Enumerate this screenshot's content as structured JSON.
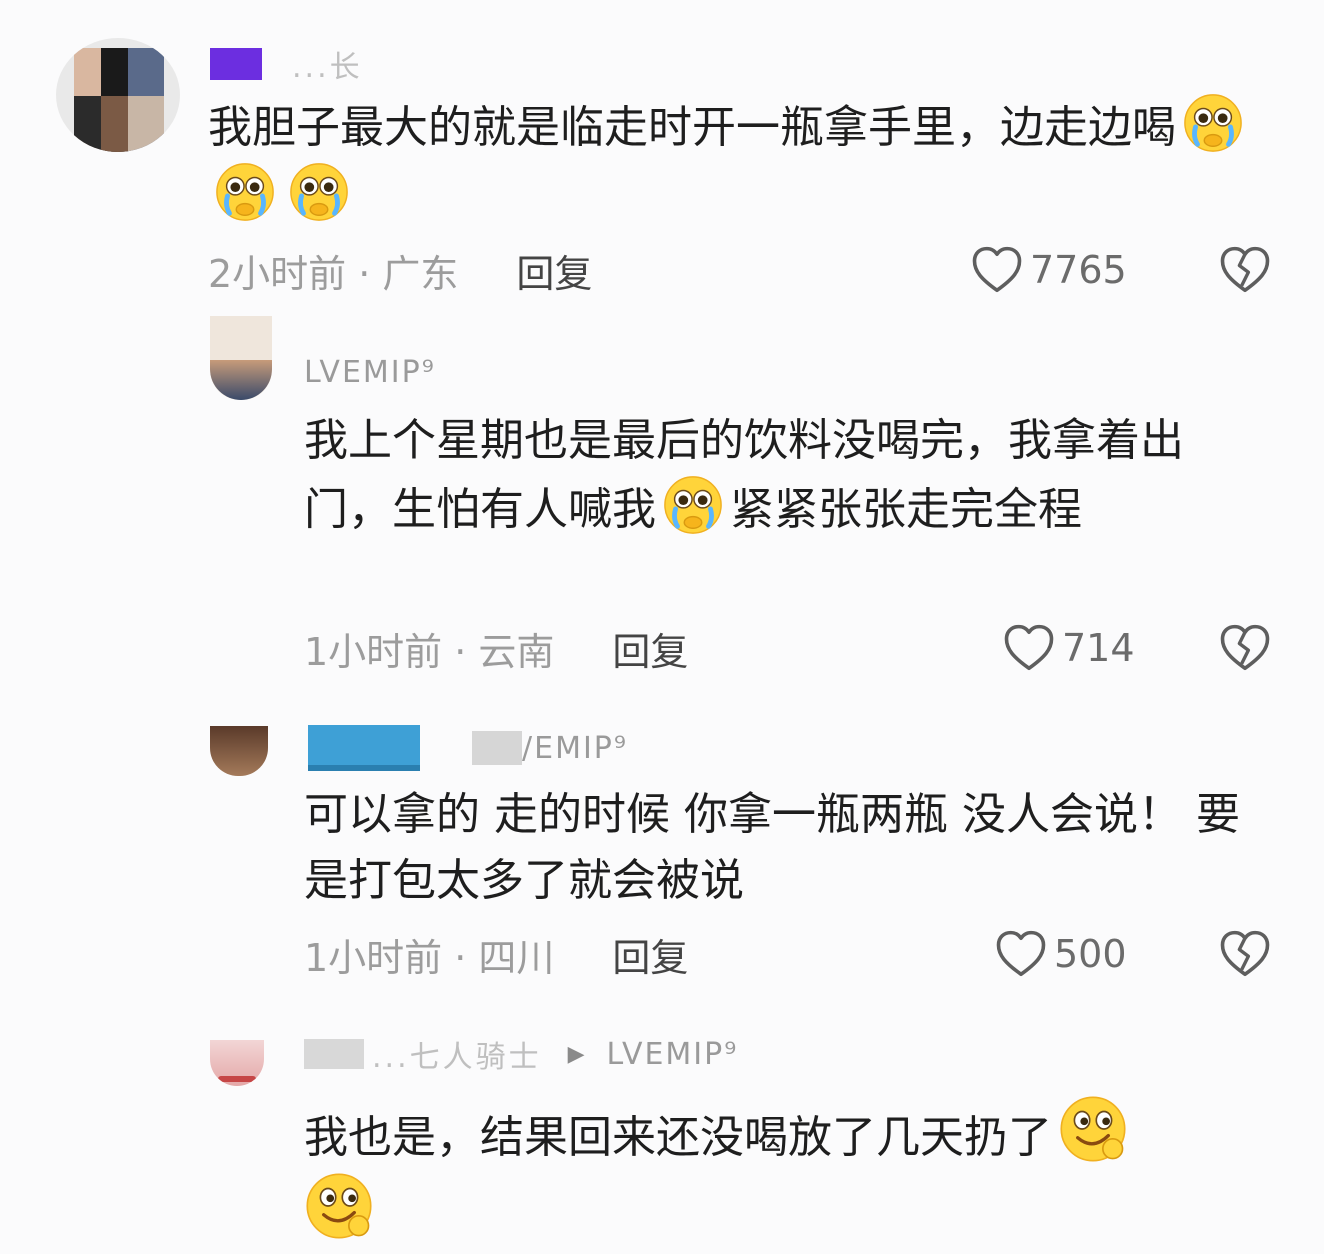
{
  "comments": [
    {
      "username": "...长",
      "text_parts": [
        "我胆子最大的就是临走时开一瓶拿手里，边走边喝"
      ],
      "time_location": "2小时前 · 广东",
      "reply_label": "回复",
      "likes": "7765"
    },
    {
      "username": "LVEMIP⁹",
      "text_parts": [
        "我上个星期也是最后的饮料没喝完，我拿着出门，生怕有人喊我",
        "紧紧张张走完全程"
      ],
      "time_location": "1小时前 · 云南",
      "reply_label": "回复",
      "likes": "714"
    },
    {
      "reply_to": "/EMIP⁹",
      "text_parts": [
        "可以拿的 走的时候 你拿一瓶两瓶 没人会说！  要是打包太多了就会被说"
      ],
      "time_location": "1小时前 · 四川",
      "reply_label": "回复",
      "likes": "500"
    },
    {
      "username": "...七人骑士",
      "reply_to": "LVEMIP⁹",
      "text_parts": [
        "我也是，结果回来还没喝放了几天扔了"
      ]
    }
  ],
  "icons": {
    "like": "heart-outline-icon",
    "dislike": "broken-heart-icon",
    "emoji_cry": "crying-face-emoji-icon",
    "emoji_smirk": "wink-smirk-emoji-icon",
    "reply_arrow": "triangle-right-icon"
  },
  "colors": {
    "background": "#fbfbfc",
    "text": "#1e1e1e",
    "meta": "#9c9c9c",
    "name_block_1": "#6c2ee0",
    "name_block_3": "#3ea0d6"
  }
}
